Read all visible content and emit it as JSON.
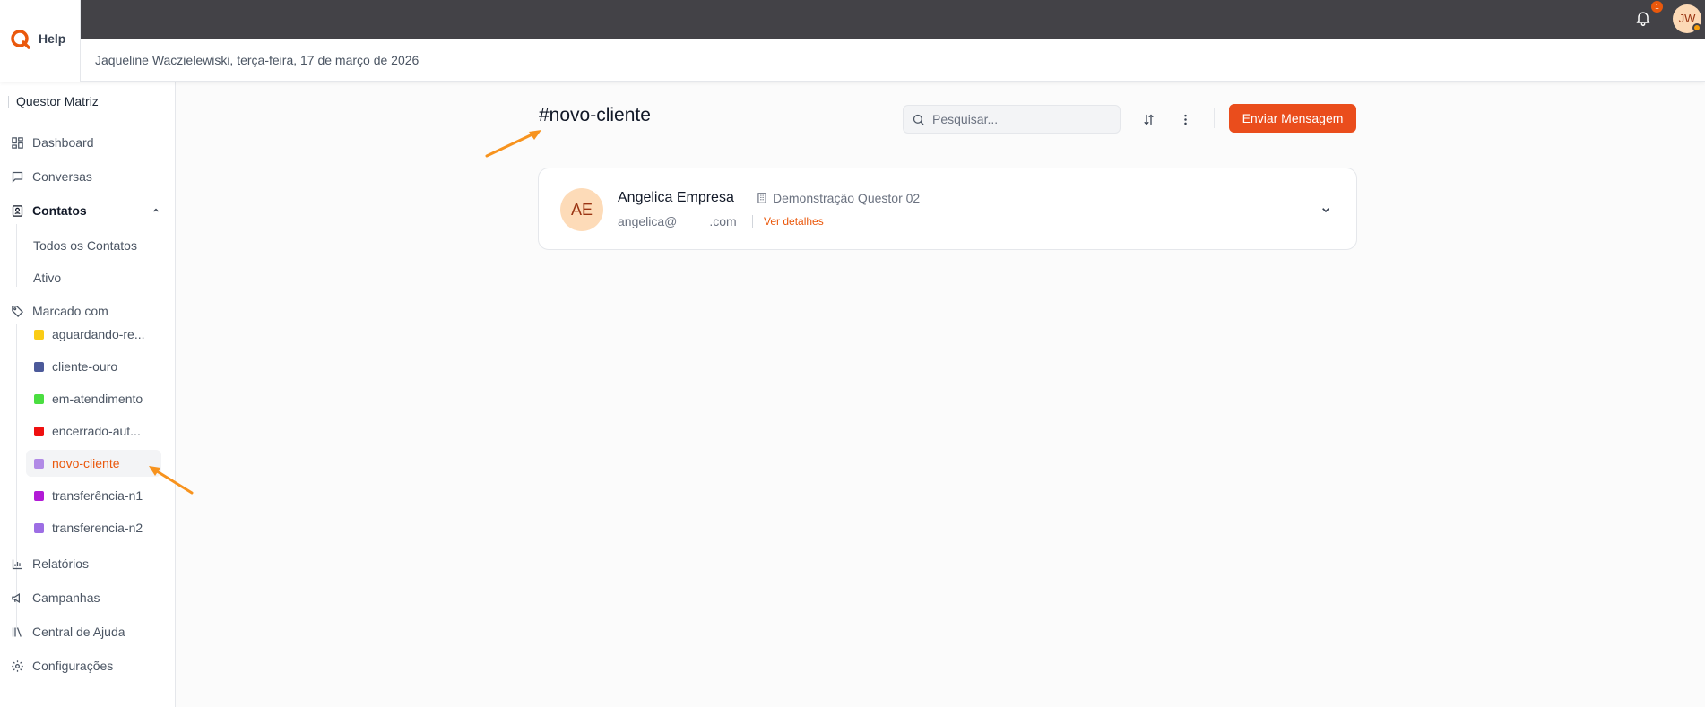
{
  "app": {
    "name": "Help",
    "brand_color": "#ea580c",
    "topbar_color": "#434247"
  },
  "header": {
    "notification_count": "1",
    "user_initials": "JW",
    "greeting": "Jaqueline Waczielewiski, terça-feira, 17 de março de 2026"
  },
  "sidebar": {
    "org": "Questor Matriz",
    "items": {
      "dashboard": {
        "label": "Dashboard",
        "icon": "grid-icon"
      },
      "conversas": {
        "label": "Conversas",
        "icon": "chat-icon"
      },
      "contatos": {
        "label": "Contatos",
        "icon": "contact-book-icon"
      },
      "todos": {
        "label": "Todos os Contatos"
      },
      "ativo": {
        "label": "Ativo"
      },
      "marcado": {
        "label": "Marcado com",
        "icon": "tag-icon"
      },
      "relatorios": {
        "label": "Relatórios",
        "icon": "bar-chart-icon"
      },
      "campanhas": {
        "label": "Campanhas",
        "icon": "megaphone-icon"
      },
      "central": {
        "label": "Central de Ajuda",
        "icon": "library-icon"
      },
      "config": {
        "label": "Configurações",
        "icon": "gear-icon"
      }
    },
    "tags": [
      {
        "label": "aguardando-re...",
        "color": "#facc15"
      },
      {
        "label": "cliente-ouro",
        "color": "#4c5a9a"
      },
      {
        "label": "em-atendimento",
        "color": "#4ade40"
      },
      {
        "label": "encerrado-aut...",
        "color": "#ef1010"
      },
      {
        "label": "novo-cliente",
        "color": "#b18ae6"
      },
      {
        "label": "transferência-n1",
        "color": "#b21ad6"
      },
      {
        "label": "transferencia-n2",
        "color": "#9d6ee4"
      }
    ]
  },
  "main": {
    "title": "#novo-cliente",
    "search_placeholder": "Pesquisar...",
    "send_label": "Enviar Mensagem",
    "contact": {
      "initials": "AE",
      "name": "Angelica Empresa",
      "company": "Demonstração Questor 02",
      "email_user": "angelica@",
      "email_domain": ".com",
      "details_link": "Ver detalhes"
    }
  },
  "annotation_color": "#f7931e"
}
